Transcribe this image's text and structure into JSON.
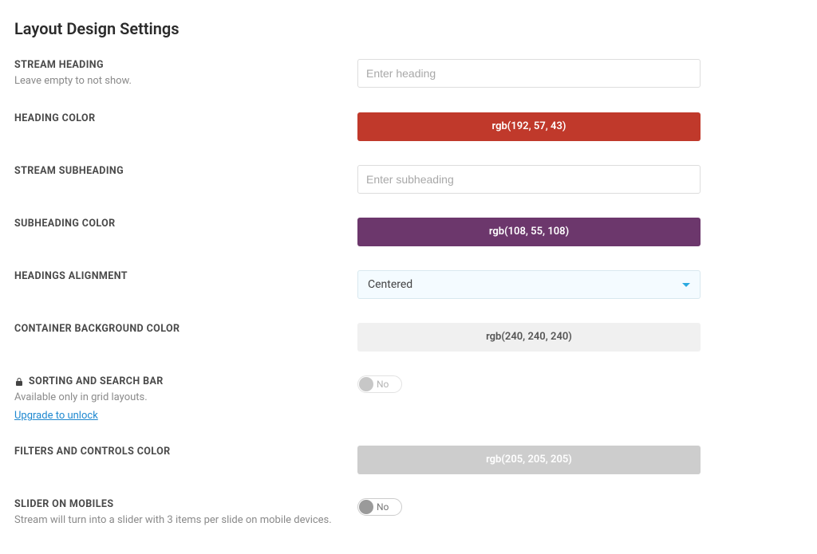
{
  "page": {
    "title": "Layout Design Settings"
  },
  "fields": {
    "stream_heading": {
      "label": "STREAM HEADING",
      "help": "Leave empty to not show.",
      "placeholder": "Enter heading"
    },
    "heading_color": {
      "label": "HEADING COLOR",
      "value_text": "rgb(192, 57, 43)",
      "value_css": "rgb(192,57,43)"
    },
    "stream_subheading": {
      "label": "STREAM SUBHEADING",
      "placeholder": "Enter subheading"
    },
    "subheading_color": {
      "label": "SUBHEADING COLOR",
      "value_text": "rgb(108, 55, 108)",
      "value_css": "rgb(108,55,108)"
    },
    "headings_alignment": {
      "label": "HEADINGS ALIGNMENT",
      "selected": "Centered"
    },
    "container_bg": {
      "label": "CONTAINER BACKGROUND COLOR",
      "value_text": "rgb(240, 240, 240)",
      "value_css": "rgb(240,240,240)",
      "text_color": "#555"
    },
    "sorting_search": {
      "label": "SORTING AND SEARCH BAR",
      "help": "Available only in grid layouts.",
      "upgrade": "Upgrade to unlock",
      "toggle_label": "No"
    },
    "filters_controls_color": {
      "label": "FILTERS AND CONTROLS COLOR",
      "value_text": "rgb(205, 205, 205)",
      "value_css": "rgb(205,205,205)",
      "text_color": "#fff"
    },
    "slider_mobiles": {
      "label": "SLIDER ON MOBILES",
      "help": "Stream will turn into a slider with 3 items per slide on mobile devices.",
      "toggle_label": "No"
    }
  }
}
